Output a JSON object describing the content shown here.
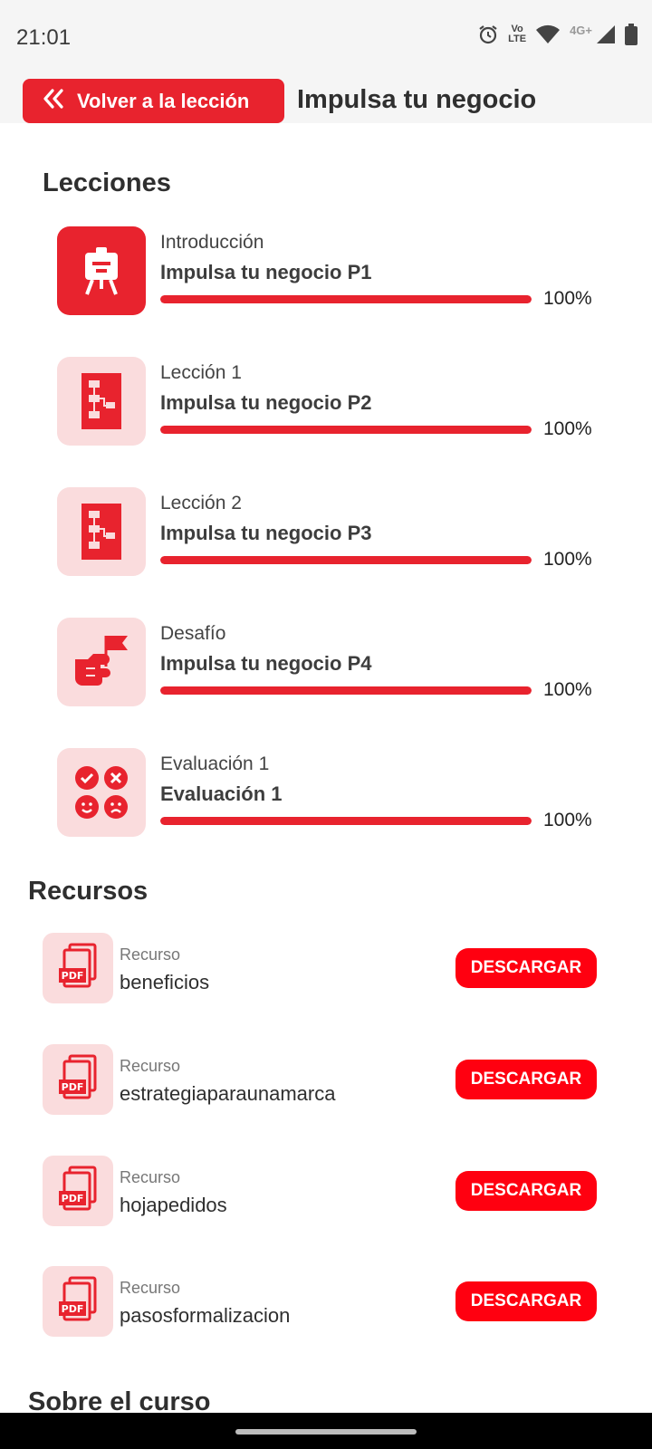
{
  "status_bar": {
    "time": "21:01",
    "icons": [
      "alarm-icon",
      "volte-icon",
      "wifi-icon",
      "4g-icon",
      "signal-icon",
      "battery-icon"
    ],
    "volte_label_top": "Vo",
    "volte_label_bottom": "LTE",
    "network_label": "4G+"
  },
  "header": {
    "back_label": "Volver a la lección",
    "title": "Impulsa tu negocio"
  },
  "lessons_section": {
    "title": "Lecciones",
    "items": [
      {
        "type": "Introducción",
        "name": "Impulsa tu negocio P1",
        "progress": 1.0,
        "progress_label": "100%",
        "icon": "presentation-board-icon",
        "active": true
      },
      {
        "type": "Lección 1",
        "name": "Impulsa tu negocio P2",
        "progress": 1.0,
        "progress_label": "100%",
        "icon": "flowchart-icon",
        "active": false
      },
      {
        "type": "Lección 2",
        "name": "Impulsa tu negocio P3",
        "progress": 1.0,
        "progress_label": "100%",
        "icon": "flowchart-icon",
        "active": false
      },
      {
        "type": "Desafío",
        "name": "Impulsa tu negocio P4",
        "progress": 1.0,
        "progress_label": "100%",
        "icon": "fist-flag-icon",
        "active": false
      },
      {
        "type": "Evaluación 1",
        "name": "Evaluación 1",
        "progress": 1.0,
        "progress_label": "100%",
        "icon": "evaluation-faces-icon",
        "active": false
      }
    ]
  },
  "resources_section": {
    "title": "Recursos",
    "items": [
      {
        "type": "Recurso",
        "name": "beneficios",
        "button": "DESCARGAR",
        "icon": "pdf-icon"
      },
      {
        "type": "Recurso",
        "name": "estrategiaparaunamarca",
        "button": "DESCARGAR",
        "icon": "pdf-icon"
      },
      {
        "type": "Recurso",
        "name": "hojapedidos",
        "button": "DESCARGAR",
        "icon": "pdf-icon"
      },
      {
        "type": "Recurso",
        "name": "pasosformalizacion",
        "button": "DESCARGAR",
        "icon": "pdf-icon"
      }
    ]
  },
  "about_section": {
    "title": "Sobre el curso"
  },
  "colors": {
    "accent": "#e8232e",
    "button_red": "#ff0010",
    "icon_bg": "#fadcdd"
  }
}
